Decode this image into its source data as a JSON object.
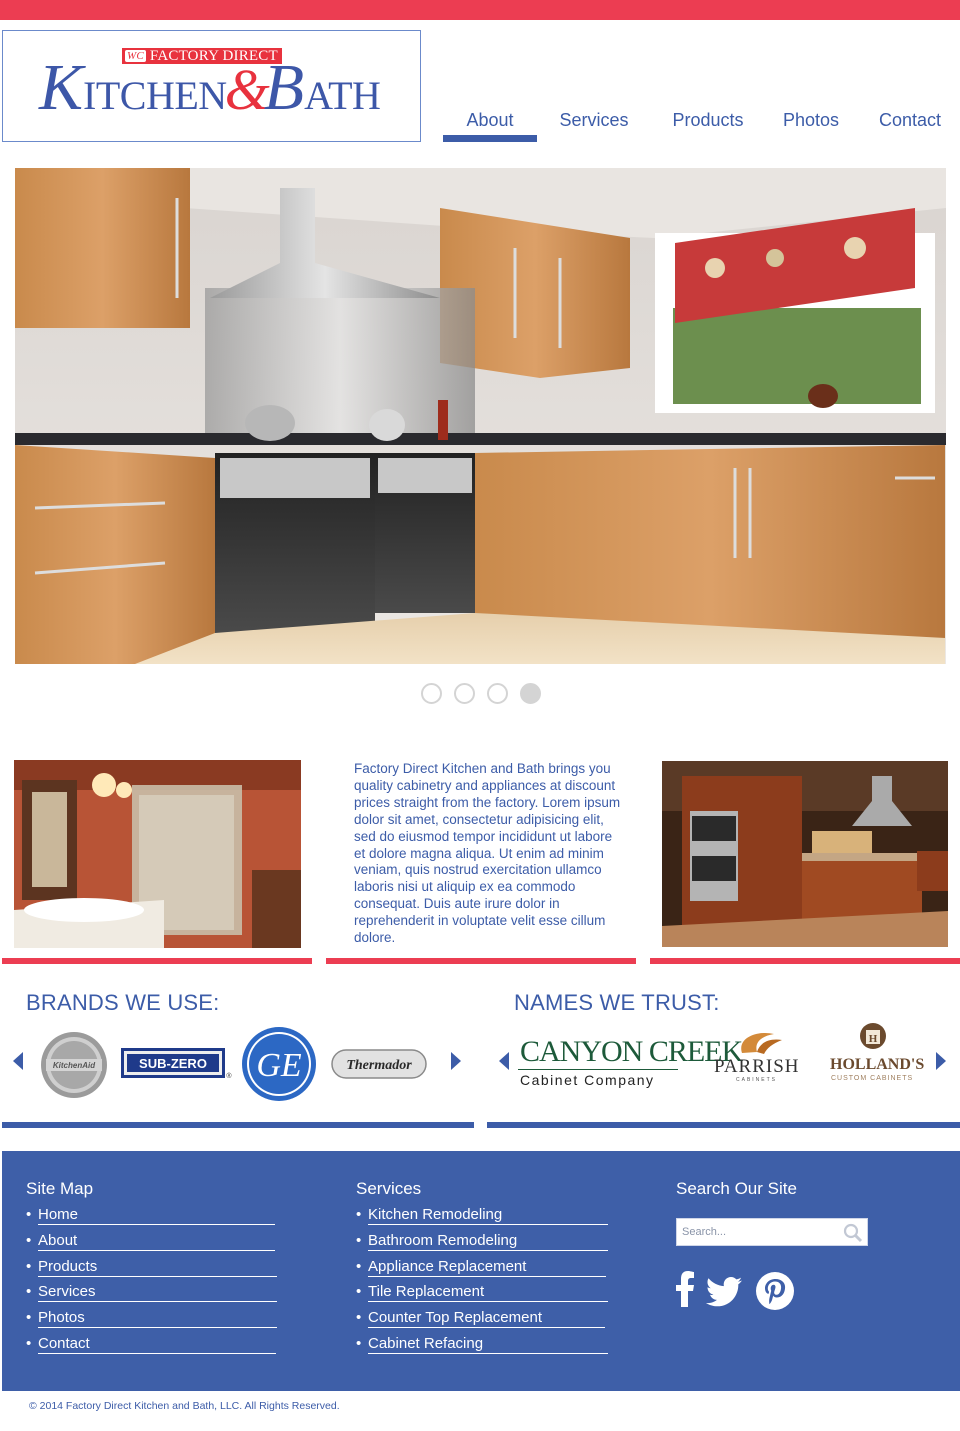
{
  "brand": {
    "tagline_mark": "WC",
    "tagline": "FACTORY DIRECT",
    "name_part1": "K",
    "name_part1_rest": "ITCHEN",
    "ampersand": "&",
    "name_part2": "B",
    "name_part2_rest": "ATH"
  },
  "nav": {
    "items": [
      {
        "label": "About",
        "active": true
      },
      {
        "label": "Services",
        "active": false
      },
      {
        "label": "Products",
        "active": false
      },
      {
        "label": "Photos",
        "active": false
      },
      {
        "label": "Contact",
        "active": false
      }
    ]
  },
  "slider": {
    "slide_count": 4,
    "active_slide": 4
  },
  "intro": {
    "text": "Factory Direct Kitchen and Bath brings you quality cabinetry and appliances at discount prices straight from the factory. Lorem ipsum dolor sit amet, consectetur adipisicing elit, sed do eiusmod tempor incididunt ut labore et dolore magna aliqua. Ut enim ad minim veniam, quis nostrud exercitation ullamco laboris nisi ut aliquip ex ea commodo consequat. Duis aute irure dolor in reprehenderit in voluptate velit esse cillum dolore."
  },
  "brands_section": {
    "title": "BRANDS WE USE:",
    "logos": [
      "KitchenAid",
      "SUB-ZERO",
      "GE",
      "Thermador"
    ]
  },
  "names_section": {
    "title": "NAMES WE TRUST:",
    "logos": [
      {
        "name": "CANYON CREEK",
        "sub": "Cabinet Company"
      },
      {
        "name": "PARRISH",
        "sub": "CABINETS"
      },
      {
        "name": "HOLLAND'S",
        "sub": "CUSTOM CABINETS"
      }
    ]
  },
  "footer": {
    "sitemap": {
      "title": "Site Map",
      "links": [
        "Home",
        "About",
        "Products",
        "Services",
        "Photos",
        "Contact"
      ]
    },
    "services": {
      "title": "Services",
      "links": [
        "Kitchen Remodeling",
        "Bathroom Remodeling",
        "Appliance Replacement",
        "Tile Replacement",
        "Counter Top Replacement",
        "Cabinet Refacing"
      ]
    },
    "search": {
      "title": "Search Our Site",
      "placeholder": "Search..."
    },
    "social": [
      "facebook-icon",
      "twitter-icon",
      "pinterest-icon"
    ]
  },
  "copyright": "© 2014 Factory Direct Kitchen and Bath, LLC. All Rights Reserved.",
  "colors": {
    "accent_red": "#ec3d52",
    "brand_blue": "#3c5ca8",
    "footer_blue": "#3e5fa8"
  }
}
